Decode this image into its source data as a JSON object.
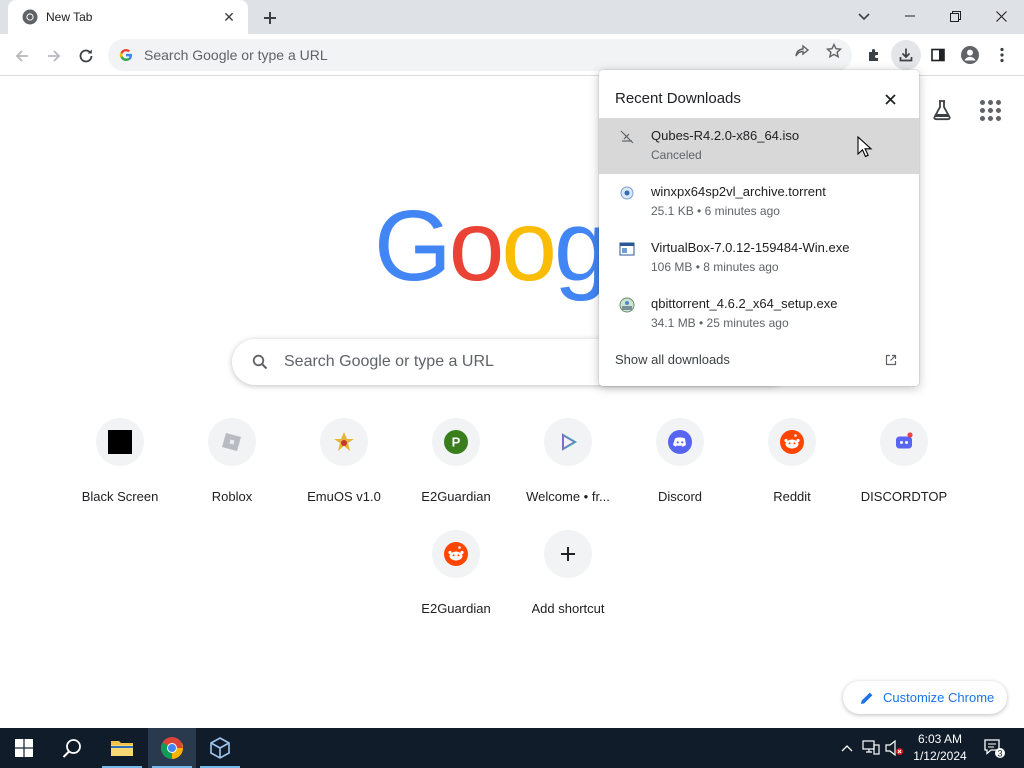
{
  "browser": {
    "tab": {
      "title": "New Tab"
    },
    "omnibox": {
      "placeholder": "Search Google or type a URL"
    }
  },
  "ntp": {
    "logo": [
      "G",
      "o",
      "o",
      "g"
    ],
    "logo_colors": [
      "#4285f4",
      "#ea4335",
      "#fbbc05",
      "#4285f4"
    ],
    "search_placeholder": "Search Google or type a URL",
    "shortcuts": [
      {
        "label": "Black Screen",
        "icon": "black-square-icon"
      },
      {
        "label": "Roblox",
        "icon": "roblox-icon"
      },
      {
        "label": "EmuOS v1.0",
        "icon": "emuos-icon"
      },
      {
        "label": "E2Guardian",
        "icon": "letter-p-icon"
      },
      {
        "label": "Welcome • fr...",
        "icon": "play-triangle-icon"
      },
      {
        "label": "Discord",
        "icon": "discord-icon"
      },
      {
        "label": "Reddit",
        "icon": "reddit-icon"
      },
      {
        "label": "DISCORDTOP",
        "icon": "discord-bot-icon"
      },
      {
        "label": "E2Guardian",
        "icon": "reddit-icon"
      },
      {
        "label": "Add shortcut",
        "icon": "plus-icon"
      }
    ],
    "customize_label": "Customize Chrome"
  },
  "downloads": {
    "title": "Recent Downloads",
    "items": [
      {
        "name": "Qubes-R4.2.0-x86_64.iso",
        "status": "Canceled",
        "icon": "canceled-download-icon"
      },
      {
        "name": "winxpx64sp2vl_archive.torrent",
        "status": "25.1 KB • 6 minutes ago",
        "icon": "torrent-file-icon"
      },
      {
        "name": "VirtualBox-7.0.12-159484-Win.exe",
        "status": "106 MB • 8 minutes ago",
        "icon": "exe-window-icon"
      },
      {
        "name": "qbittorrent_4.6.2_x64_setup.exe",
        "status": "34.1 MB • 25 minutes ago",
        "icon": "qbittorrent-icon"
      }
    ],
    "show_all": "Show all downloads"
  },
  "taskbar": {
    "time": "6:03 AM",
    "date": "1/12/2024",
    "notification_count": "3"
  },
  "colors": {
    "accent": "#1a73e8",
    "tabstrip": "#dee1e6",
    "taskbar": "#101c2a"
  }
}
